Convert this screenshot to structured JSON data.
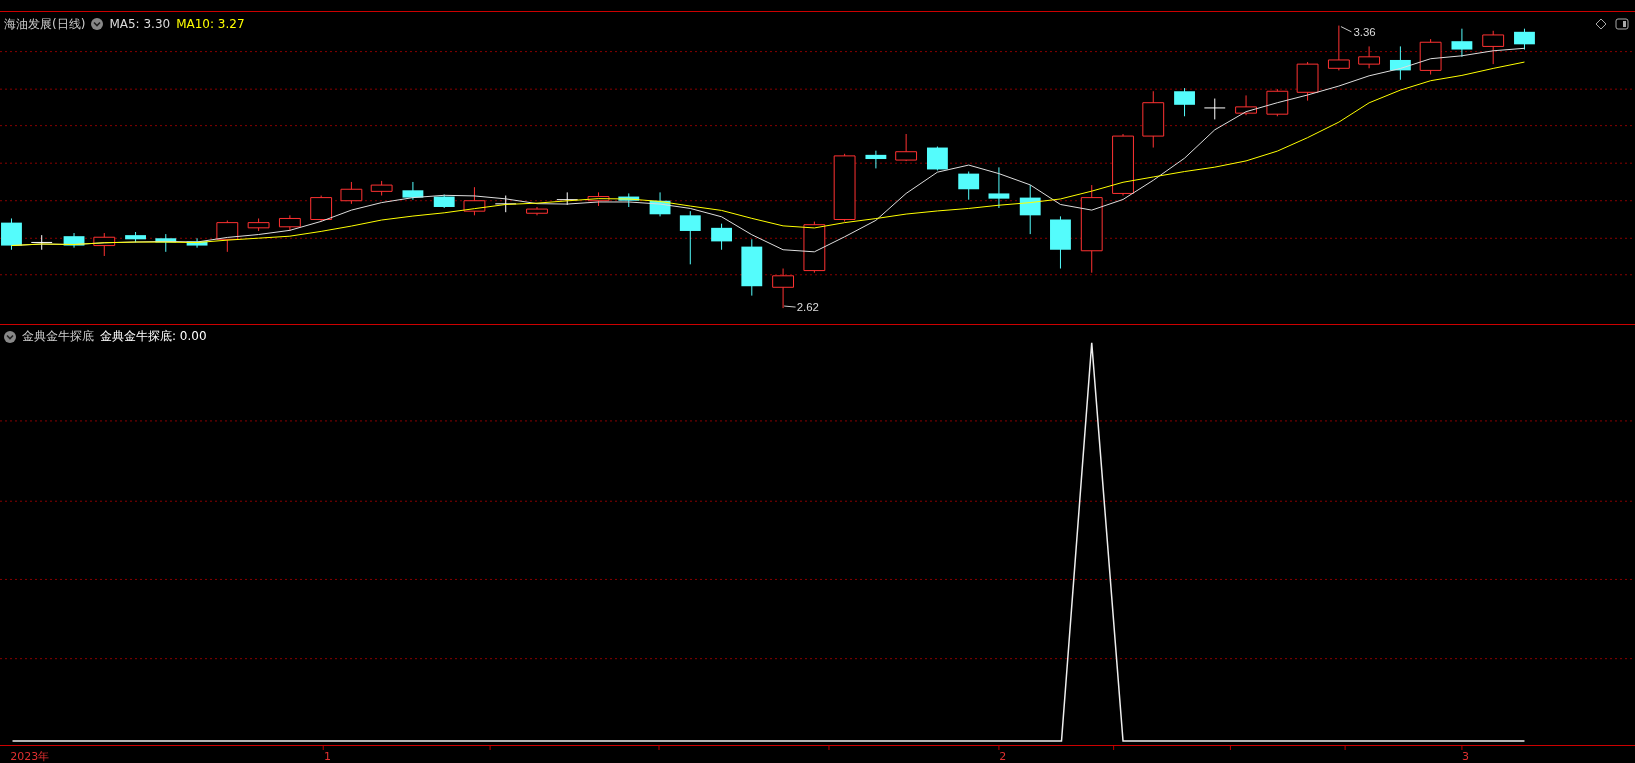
{
  "price_panel": {
    "title": "海油发展(日线)",
    "indicators": [
      {
        "label": "MA5: 3.30",
        "color": "#dddddd"
      },
      {
        "label": "MA10: 3.27",
        "color": "#ffff00"
      }
    ],
    "high_label": "3.36",
    "low_label": "2.62"
  },
  "indicator_panel": {
    "name": "金典金牛探底",
    "value_label": "金典金牛探底: 0.00"
  },
  "time_axis": [
    "2023年",
    "1",
    "2",
    "3"
  ]
}
